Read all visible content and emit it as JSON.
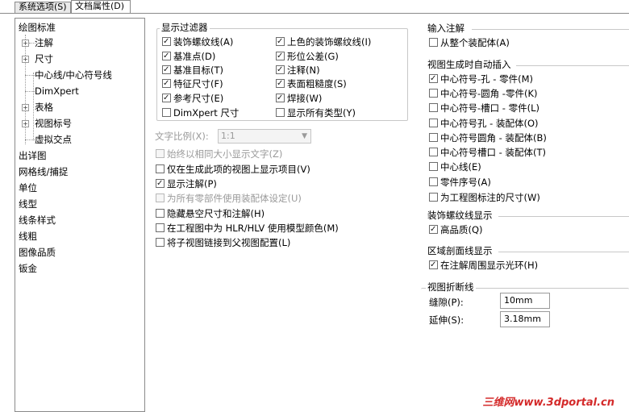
{
  "tabs": [
    "系统选项(S)",
    "文档属性(D)"
  ],
  "tree": {
    "items": [
      {
        "label": "绘图标准"
      },
      {
        "label": "注解"
      },
      {
        "label": "尺寸"
      },
      {
        "label": "中心线/中心符号线"
      },
      {
        "label": "DimXpert"
      },
      {
        "label": "表格"
      },
      {
        "label": "视图标号"
      },
      {
        "label": "虚拟交点"
      },
      {
        "label": "出详图"
      },
      {
        "label": "网格线/捕捉"
      },
      {
        "label": "单位"
      },
      {
        "label": "线型"
      },
      {
        "label": "线条样式"
      },
      {
        "label": "线粗"
      },
      {
        "label": "图像品质"
      },
      {
        "label": "钣金"
      }
    ]
  },
  "display_filter": {
    "title": "显示过滤器",
    "left": [
      {
        "label": "装饰螺纹线(A)",
        "checked": true
      },
      {
        "label": "基准点(D)",
        "checked": true
      },
      {
        "label": "基准目标(T)",
        "checked": true
      },
      {
        "label": "特征尺寸(F)",
        "checked": true
      },
      {
        "label": "参考尺寸(E)",
        "checked": true
      },
      {
        "label": "DimXpert 尺寸",
        "checked": false
      }
    ],
    "right": [
      {
        "label": "上色的装饰螺纹线(I)",
        "checked": true
      },
      {
        "label": "形位公差(G)",
        "checked": true
      },
      {
        "label": "注释(N)",
        "checked": true
      },
      {
        "label": "表面粗糙度(S)",
        "checked": true
      },
      {
        "label": "焊接(W)",
        "checked": true
      },
      {
        "label": "显示所有类型(Y)",
        "checked": false
      }
    ]
  },
  "text_scale": {
    "label": "文字比例(X):",
    "value": "1:1"
  },
  "options": [
    {
      "label": "始终以相同大小显示文字(Z)",
      "checked": false,
      "disabled": true
    },
    {
      "label": "仅在生成此项的视图上显示项目(V)",
      "checked": false,
      "disabled": false
    },
    {
      "label": "显示注解(P)",
      "checked": true,
      "disabled": false
    },
    {
      "label": "为所有零部件使用装配体设定(U)",
      "checked": false,
      "disabled": true
    },
    {
      "label": "隐藏悬空尺寸和注解(H)",
      "checked": false,
      "disabled": false
    },
    {
      "label": "在工程图中为 HLR/HLV 使用模型颜色(M)",
      "checked": false,
      "disabled": false
    },
    {
      "label": "将子视图链接到父视图配置(L)",
      "checked": false,
      "disabled": false
    }
  ],
  "import_annotations": {
    "title": "输入注解",
    "items": [
      {
        "label": "从整个装配体(A)",
        "checked": false
      }
    ]
  },
  "auto_insert": {
    "title": "视图生成时自动插入",
    "items": [
      {
        "label": "中心符号-孔 - 零件(M)",
        "checked": true
      },
      {
        "label": "中心符号-圆角 -零件(K)",
        "checked": false
      },
      {
        "label": "中心符号-槽口 - 零件(L)",
        "checked": false
      },
      {
        "label": "中心符号孔 - 装配体(O)",
        "checked": false
      },
      {
        "label": "中心符号圆角 - 装配体(B)",
        "checked": false
      },
      {
        "label": "中心符号槽口 - 装配体(T)",
        "checked": false
      },
      {
        "label": "中心线(E)",
        "checked": false
      },
      {
        "label": "零件序号(A)",
        "checked": false
      },
      {
        "label": "为工程图标注的尺寸(W)",
        "checked": false
      }
    ]
  },
  "cosmetic_thread": {
    "title": "装饰螺纹线显示",
    "items": [
      {
        "label": "高品质(Q)",
        "checked": true
      }
    ]
  },
  "area_hatch": {
    "title": "区域剖面线显示",
    "items": [
      {
        "label": "在注解周围显示光环(H)",
        "checked": true
      }
    ]
  },
  "view_break": {
    "title": "视图折断线",
    "gap_label": "缝隙(P):",
    "gap_value": "10mm",
    "extension_label": "延伸(S):",
    "extension_value": "3.18mm"
  },
  "watermark": "三维网www.3dportal.cn"
}
